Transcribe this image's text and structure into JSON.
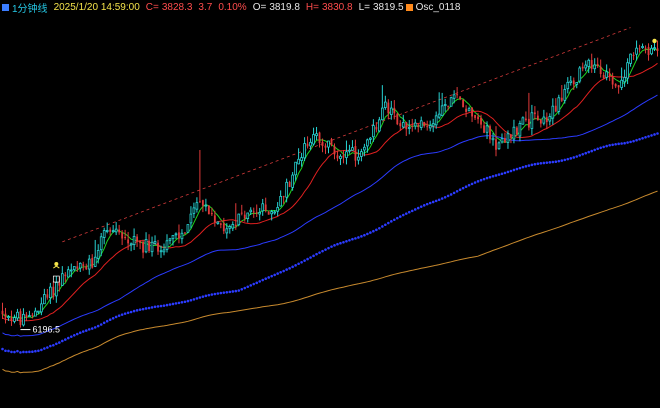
{
  "header": {
    "period": "1分钟线",
    "datetime": "2025/1/20 14:59:00",
    "close_label": "C=",
    "close_value": "3828.3",
    "change": "3.7",
    "change_pct": "0.10%",
    "open_label": "O=",
    "open_value": "3819.8",
    "high_label": "H=",
    "high_value": "3830.8",
    "low_label": "L=",
    "low_value": "3819.5",
    "indicator": "Osc_0118"
  },
  "chart_data": {
    "type": "candlestick",
    "bars": 220,
    "y_range": [
      3767.0,
      3834.0
    ],
    "annotations": {
      "low_marker": "6196.5"
    },
    "overlays": [
      {
        "color": "#1fd41f",
        "style": "line",
        "period": 5
      },
      {
        "color": "#e02020",
        "style": "line",
        "period": 15
      },
      {
        "color": "#2b3bff",
        "style": "line",
        "period": 40
      },
      {
        "color": "#2b3bff",
        "style": "dotted",
        "period": 80
      },
      {
        "color": "#c88a2e",
        "style": "line",
        "period": 160
      }
    ],
    "colors": {
      "up": "#27d3d3",
      "down": "#e03a3a",
      "background": "#000000"
    },
    "anchors": [
      [
        0,
        3783
      ],
      [
        8,
        3781
      ],
      [
        12,
        3784
      ],
      [
        16,
        3786
      ],
      [
        20,
        3789
      ],
      [
        30,
        3791
      ],
      [
        34,
        3798
      ],
      [
        42,
        3795
      ],
      [
        50,
        3794
      ],
      [
        60,
        3796
      ],
      [
        66,
        3802
      ],
      [
        74,
        3798
      ],
      [
        84,
        3800
      ],
      [
        92,
        3801
      ],
      [
        98,
        3808
      ],
      [
        104,
        3814
      ],
      [
        112,
        3810
      ],
      [
        120,
        3810
      ],
      [
        128,
        3818
      ],
      [
        136,
        3814
      ],
      [
        144,
        3816
      ],
      [
        152,
        3820
      ],
      [
        158,
        3817
      ],
      [
        166,
        3811
      ],
      [
        174,
        3816
      ],
      [
        182,
        3816
      ],
      [
        190,
        3823
      ],
      [
        198,
        3826
      ],
      [
        206,
        3822
      ],
      [
        212,
        3829
      ],
      [
        219,
        3828
      ]
    ]
  }
}
